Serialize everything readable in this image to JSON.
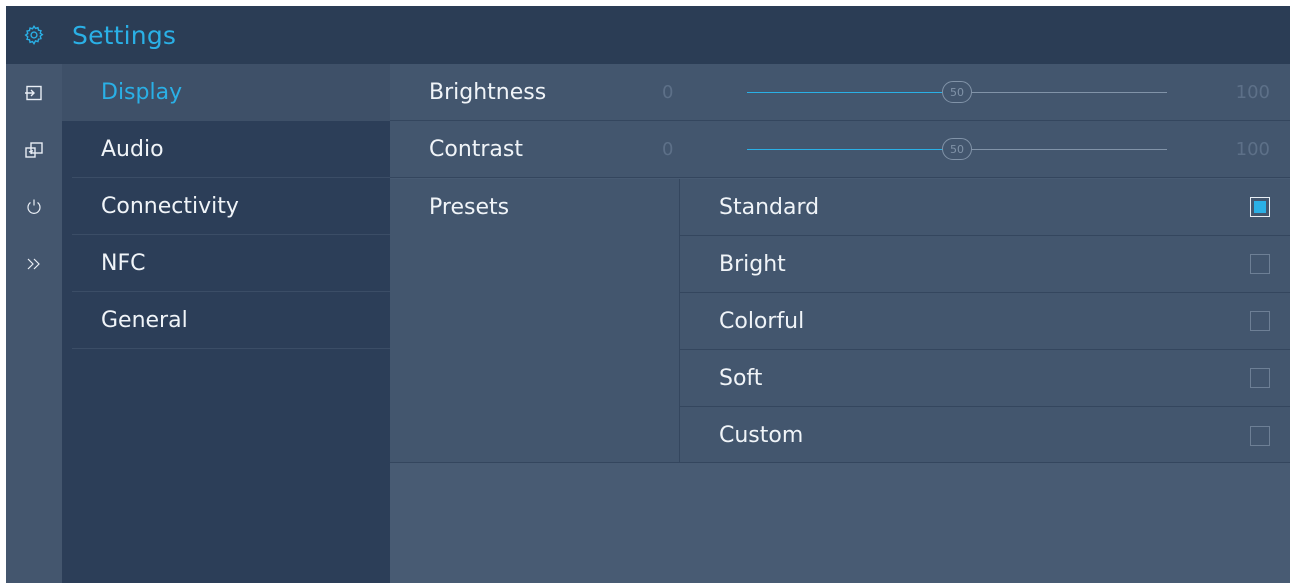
{
  "app": {
    "title": "Settings"
  },
  "colors": {
    "accent": "#2ab0e6",
    "titlebar": "#2b3d55",
    "sidebar": "#2c3e58",
    "content": "#43566e"
  },
  "rail": {
    "items": [
      {
        "icon": "input-icon"
      },
      {
        "icon": "screen-icon"
      },
      {
        "icon": "power-icon"
      },
      {
        "icon": "more-icon"
      }
    ]
  },
  "categories": [
    {
      "label": "Display",
      "active": true
    },
    {
      "label": "Audio",
      "active": false
    },
    {
      "label": "Connectivity",
      "active": false
    },
    {
      "label": "NFC",
      "active": false
    },
    {
      "label": "General",
      "active": false
    }
  ],
  "display": {
    "brightness": {
      "label": "Brightness",
      "min": "0",
      "max": "100",
      "value": 50,
      "value_label": "50"
    },
    "contrast": {
      "label": "Contrast",
      "min": "0",
      "max": "100",
      "value": 50,
      "value_label": "50"
    },
    "presets": {
      "label": "Presets",
      "options": [
        {
          "label": "Standard",
          "checked": true
        },
        {
          "label": "Bright",
          "checked": false
        },
        {
          "label": "Colorful",
          "checked": false
        },
        {
          "label": "Soft",
          "checked": false
        },
        {
          "label": "Custom",
          "checked": false
        }
      ]
    }
  }
}
